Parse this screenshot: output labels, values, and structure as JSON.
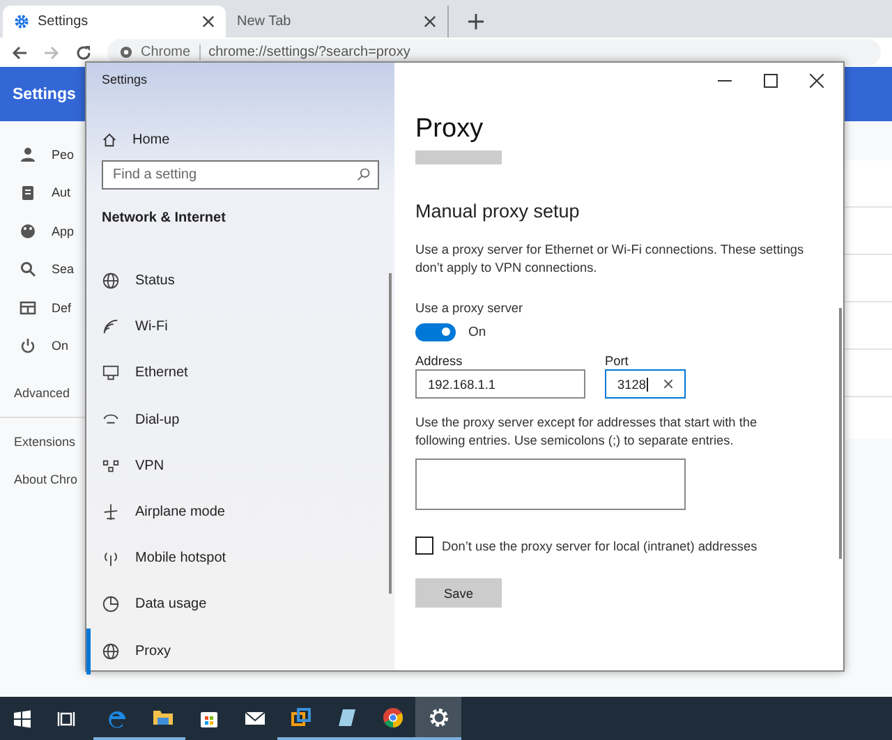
{
  "browser": {
    "tabs": [
      {
        "label": "Settings",
        "selected": true
      },
      {
        "label": "New Tab",
        "selected": false
      }
    ],
    "omnibox": {
      "chip": "Chrome",
      "url": "chrome://settings/?search=proxy"
    },
    "page_title": "Settings",
    "sidebar": [
      {
        "label": "Peo"
      },
      {
        "label": "Aut"
      },
      {
        "label": "App"
      },
      {
        "label": "Sea"
      },
      {
        "label": "Def"
      },
      {
        "label": "On"
      }
    ],
    "advanced": "Advanced",
    "links": [
      "Extensions",
      "About Chro"
    ]
  },
  "settings_window": {
    "title": "Settings",
    "home": "Home",
    "search": {
      "placeholder": "Find a setting"
    },
    "section": "Network & Internet",
    "nav": [
      {
        "label": "Status",
        "selected": false
      },
      {
        "label": "Wi-Fi",
        "selected": false
      },
      {
        "label": "Ethernet",
        "selected": false
      },
      {
        "label": "Dial-up",
        "selected": false
      },
      {
        "label": "VPN",
        "selected": false
      },
      {
        "label": "Airplane mode",
        "selected": false
      },
      {
        "label": "Mobile hotspot",
        "selected": false
      },
      {
        "label": "Data usage",
        "selected": false
      },
      {
        "label": "Proxy",
        "selected": true
      }
    ],
    "heading": "Proxy",
    "subheading": "Manual proxy setup",
    "description": "Use a proxy server for Ethernet or Wi-Fi connections. These settings don’t apply to VPN connections.",
    "use_proxy": {
      "label": "Use a proxy server",
      "on": true,
      "state_text": "On"
    },
    "address": {
      "label": "Address",
      "value": "192.168.1.1"
    },
    "port": {
      "label": "Port",
      "value": "3128"
    },
    "exceptions": {
      "description": "Use the proxy server except for addresses that start with the following entries. Use semicolons (;) to separate entries."
    },
    "bypass_local": {
      "label": "Don’t use the proxy server for local (intranet) addresses",
      "checked": false
    },
    "save": "Save"
  },
  "taskbar": {
    "apps": [
      {
        "kind": "edge",
        "running": true,
        "selected": false
      },
      {
        "kind": "explorer",
        "running": true,
        "selected": false
      },
      {
        "kind": "store",
        "running": false,
        "selected": false
      },
      {
        "kind": "mail",
        "running": false,
        "selected": false
      },
      {
        "kind": "vm",
        "running": true,
        "selected": false
      },
      {
        "kind": "notepad",
        "running": true,
        "selected": false
      },
      {
        "kind": "chrome",
        "running": true,
        "selected": false
      },
      {
        "kind": "settings",
        "running": true,
        "selected": true
      }
    ]
  }
}
